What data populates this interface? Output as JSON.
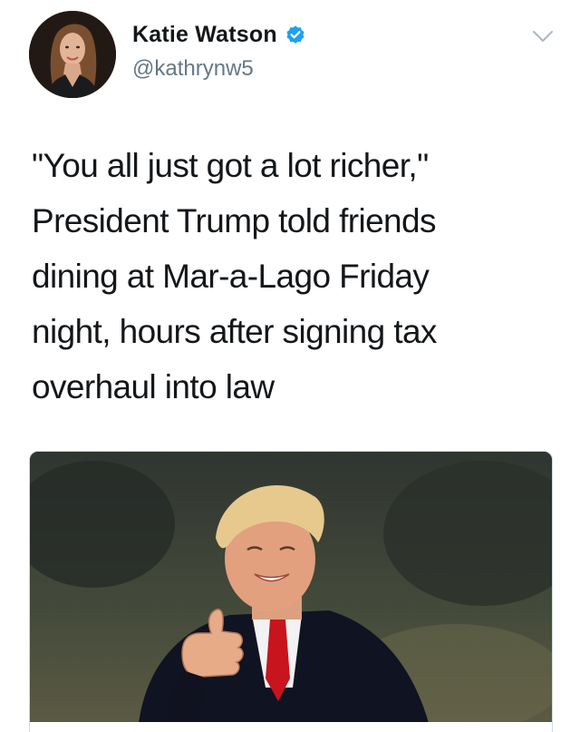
{
  "tweet": {
    "author": {
      "display_name": "Katie Watson",
      "handle": "@kathrynw5",
      "verified": true,
      "avatar_icon": "profile-photo"
    },
    "text_lines": [
      "\"You all just got a lot richer,\"",
      "President Trump told friends",
      "dining at Mar-a-Lago Friday",
      "night, hours after signing tax",
      "overhaul into law"
    ],
    "media": {
      "type": "photo",
      "icon": "news-photo"
    },
    "menu_icon": "chevron-down-icon"
  },
  "colors": {
    "text": "#14171a",
    "secondary": "#657786",
    "verified_blue": "#1da1f2"
  }
}
